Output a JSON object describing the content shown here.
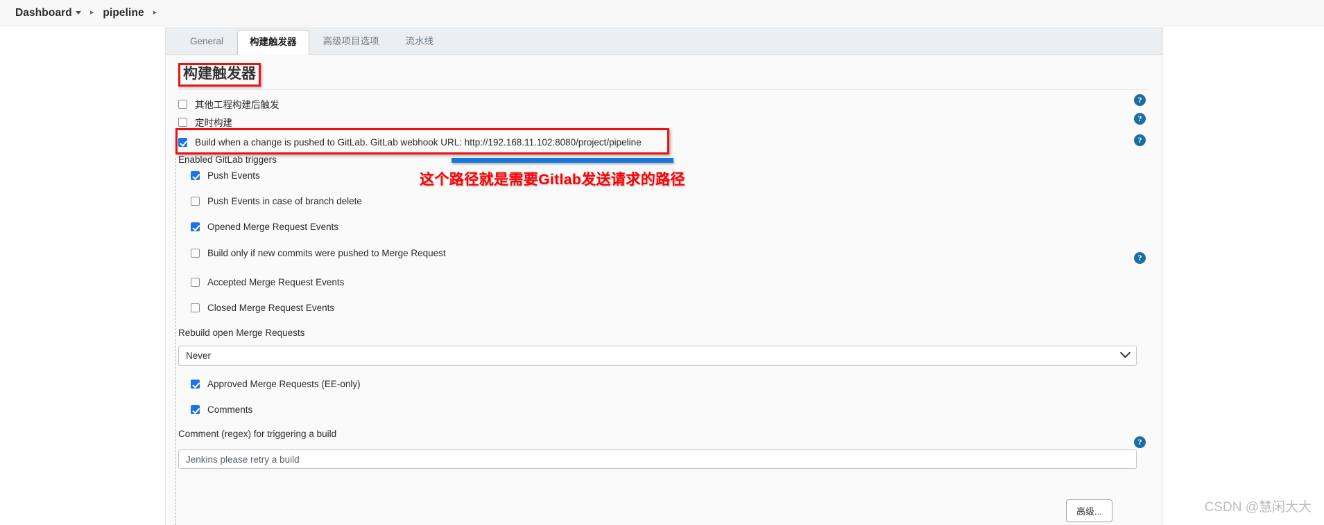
{
  "breadcrumb": {
    "items": [
      {
        "label": "Dashboard",
        "has_caret": true
      },
      {
        "label": "pipeline",
        "has_caret": false
      }
    ],
    "separator": "▸"
  },
  "tabs": [
    {
      "label": "General",
      "active": false
    },
    {
      "label": "构建触发器",
      "active": true
    },
    {
      "label": "高级项目选项",
      "active": false
    },
    {
      "label": "流水线",
      "active": false
    }
  ],
  "section": {
    "title": "构建触发器"
  },
  "top_triggers": [
    {
      "label": "其他工程构建后触发",
      "checked": false
    },
    {
      "label": "定时构建",
      "checked": false
    },
    {
      "label": "Build when a change is pushed to GitLab. GitLab webhook URL: http://192.168.11.102:8080/project/pipeline",
      "checked": true
    }
  ],
  "gitlab_section": {
    "enabled_label": "Enabled GitLab triggers",
    "events": [
      {
        "label": "Push Events",
        "checked": true
      },
      {
        "label": "Push Events in case of branch delete",
        "checked": false
      },
      {
        "label": "Opened Merge Request Events",
        "checked": true
      },
      {
        "label": "Build only if new commits were pushed to Merge Request",
        "checked": false
      },
      {
        "label": "Accepted Merge Request Events",
        "checked": false
      },
      {
        "label": "Closed Merge Request Events",
        "checked": false
      }
    ],
    "rebuild_label": "Rebuild open Merge Requests",
    "rebuild_value": "Never",
    "post_select_events": [
      {
        "label": "Approved Merge Requests (EE-only)",
        "checked": true
      },
      {
        "label": "Comments",
        "checked": true
      }
    ],
    "comment_regex_label": "Comment (regex) for triggering a build",
    "comment_regex_value": "Jenkins please retry a build"
  },
  "help_icon": "?",
  "annotation": {
    "text": "这个路径就是需要Gitlab发送请求的路径",
    "color": "#ff0000"
  },
  "highlight_color": "#ee1111",
  "accent_color": "#1a73e8",
  "footer": {
    "advanced_label": "高级..."
  },
  "watermark": "CSDN @慧闲大大"
}
